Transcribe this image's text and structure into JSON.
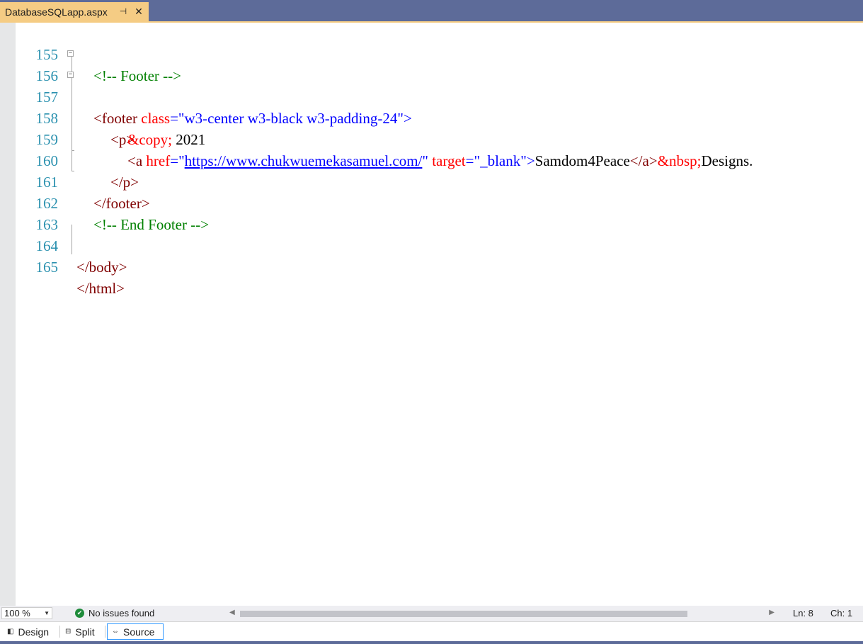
{
  "tab": {
    "title": "DatabaseSQLapp.aspx",
    "pin_glyph": "⊣",
    "close_glyph": "✕"
  },
  "editor": {
    "line_numbers": [
      "155",
      "156",
      "157",
      "158",
      "159",
      "160",
      "161",
      "162",
      "163",
      "164",
      "165"
    ],
    "lines": {
      "l155": {
        "comment": "<!-- Footer -->"
      },
      "l156": {
        "open": "<footer",
        "attr": " class",
        "eq": "=",
        "val": "\"w3-center w3-black w3-padding-24\"",
        "close": ">"
      },
      "l157": {
        "tag": "<p>"
      },
      "l158": {
        "entity": "&copy;",
        "text": " 2021"
      },
      "l159": {
        "open": "<a",
        "attr1": " href",
        "eq1": "=",
        "q1": "\"",
        "url": "https://www.chukwuemekasamuel.com/",
        "q2": "\"",
        "attr2": " target",
        "eq2": "=",
        "val2": "\"_blank\"",
        "gt": ">",
        "text": "Samdom4Peace",
        "close": "</a>",
        "entity": "&nbsp;",
        "tail": "Designs."
      },
      "l160": {
        "tag": "</p>"
      },
      "l161": {
        "tag": "</footer>"
      },
      "l162": {
        "comment": "<!-- End Footer -->"
      },
      "l164": {
        "tag": "</body>"
      },
      "l165": {
        "tag": "</html>"
      }
    }
  },
  "status": {
    "zoom": "100 %",
    "issues": "No issues found",
    "ln": "Ln: 8",
    "ch": "Ch: 1"
  },
  "views": {
    "design": "Design",
    "split": "Split",
    "source": "Source",
    "active": "source"
  },
  "colors": {
    "accent": "#f5cc84",
    "frame": "#5d6b99",
    "line_number": "#2b91af",
    "tag": "#800000",
    "attribute": "#ff0000",
    "value": "#0000ff",
    "comment": "#008000"
  }
}
